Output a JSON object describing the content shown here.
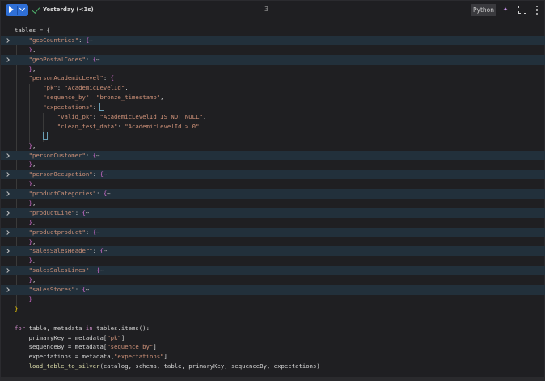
{
  "toolbar": {
    "status": "Yesterday (<1s)",
    "cell_number": "3",
    "language": "Python",
    "icons": [
      "play-icon",
      "chevron-down-icon",
      "check-icon",
      "assistant-icon",
      "expand-icon",
      "kebab-menu-icon"
    ]
  },
  "code": {
    "tables_open": "tables = {",
    "geoCountries": "\"geoCountries\"",
    "geoPostalCodes": "\"geoPostalCodes\"",
    "personAcademicLevel": "\"personAcademicLevel\"",
    "pk_key": "\"pk\"",
    "pk_val": "\"AcademicLevelId\"",
    "seq_key": "\"sequence_by\"",
    "seq_val": "\"bronze_timestamp\"",
    "exp_key": "\"expectations\"",
    "valid_pk_key": "\"valid_pk\"",
    "valid_pk_val": "\"AcademicLevelId IS NOT NULL\"",
    "clean_key": "\"clean_test_data\"",
    "clean_val": "\"AcademicLevelId > 0\"",
    "personCustomer": "\"personCustomer\"",
    "personOccupation": "\"personOccupation\"",
    "productCategories": "\"productCategories\"",
    "productLine": "\"productLine\"",
    "productproduct": "\"productproduct\"",
    "salesSalesHeader": "\"salesSalesHeader\"",
    "salesSalesLines": "\"salesSalesLines\"",
    "salesStores": "\"salesStores\"",
    "ellipsis": "⋯",
    "for_kw": "for",
    "for_vars": " table, metadata ",
    "in_kw": "in",
    "for_iter": " tables.items():",
    "l_primary": "primaryKey = metadata[",
    "l_primary_s": "\"pk\"",
    "l_sequence": "sequenceBy = metadata[",
    "l_sequence_s": "\"sequence_by\"",
    "l_expect": "expectations = metadata[",
    "l_expect_s": "\"expectations\"",
    "l_call": "load_table_to_silver",
    "l_call_args": "(catalog, schema, table, primaryKey, sequenceBy, expectations)"
  }
}
